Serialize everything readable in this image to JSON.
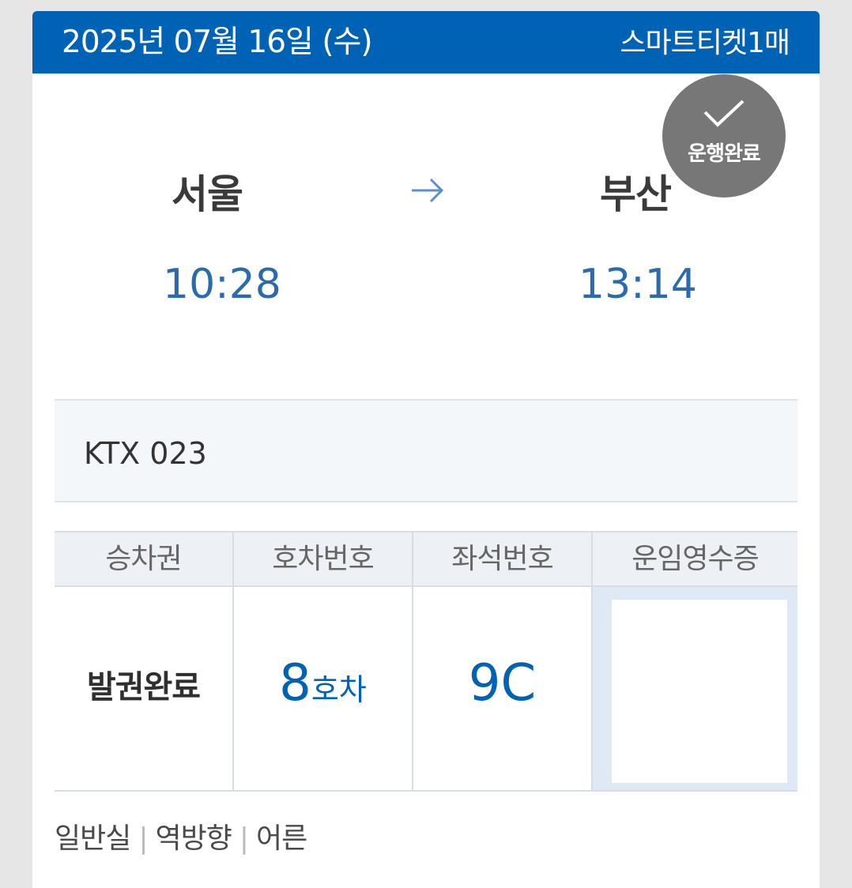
{
  "header": {
    "date": "2025년 07월 16일 (수)",
    "ticket_count": "스마트티켓1매",
    "bg_color": "#0062b4"
  },
  "route": {
    "departure": "서울",
    "arrival": "부산",
    "departure_time": "10:28",
    "arrival_time": "13:14",
    "arrow_icon": "arrow-right-icon"
  },
  "status_badge": {
    "label": "운행완료",
    "icon": "check-icon"
  },
  "train": {
    "name": "KTX 023"
  },
  "details": {
    "headers": [
      "승차권",
      "호차번호",
      "좌석번호",
      "운임영수증"
    ],
    "ticket_status": "발권완료",
    "car_number": "8",
    "car_unit": "호차",
    "seat": "9C"
  },
  "footer": {
    "class": "일반실",
    "direction": "역방향",
    "passenger": "어른"
  },
  "colors": {
    "accent_blue": "#0062b4",
    "time_blue": "#2b6aad",
    "badge_gray": "#6e6e6e"
  }
}
